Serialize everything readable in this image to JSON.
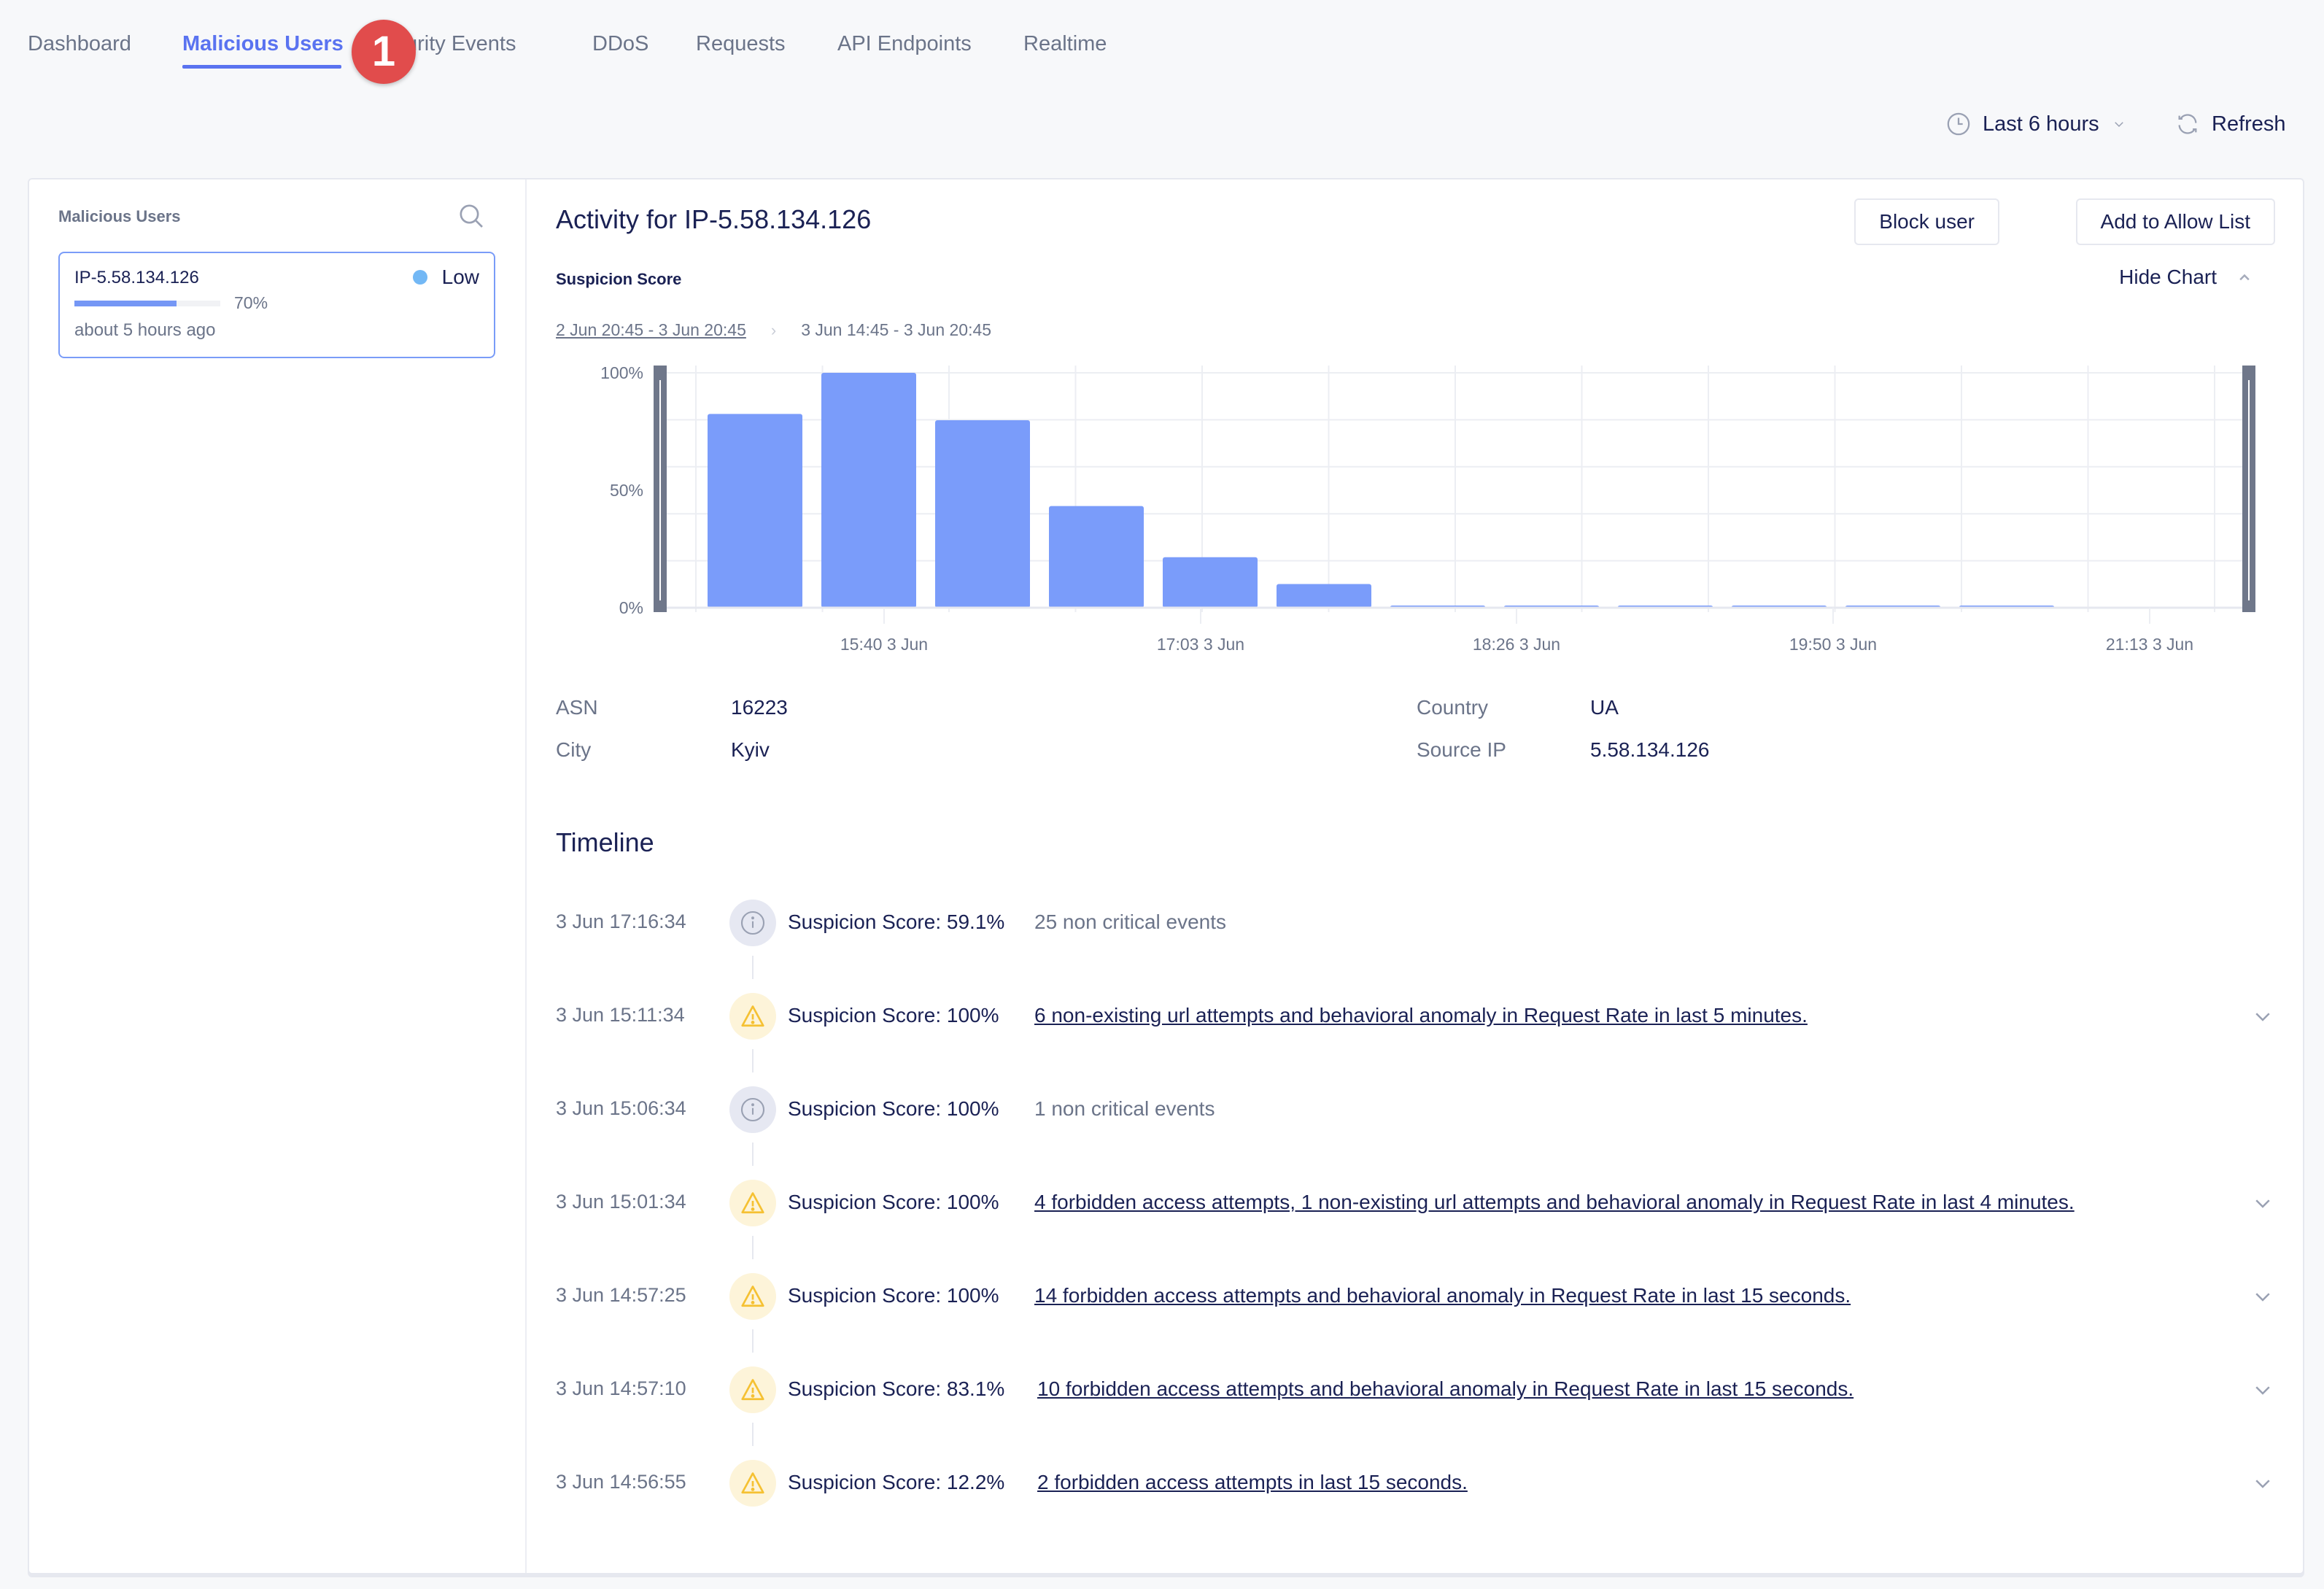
{
  "nav": {
    "tabs": [
      {
        "label": "Dashboard",
        "active": false
      },
      {
        "label": "Malicious Users",
        "active": true
      },
      {
        "label": "Security Events",
        "active": false
      },
      {
        "label": "DDoS",
        "active": false
      },
      {
        "label": "Requests",
        "active": false
      },
      {
        "label": "API Endpoints",
        "active": false
      },
      {
        "label": "Realtime",
        "active": false
      }
    ],
    "badge": "1"
  },
  "toolbar": {
    "time_range": "Last 6 hours",
    "refresh": "Refresh"
  },
  "left_panel": {
    "title": "Malicious Users",
    "users": [
      {
        "ip": "IP-5.58.134.126",
        "level": "Low",
        "level_color": "#73b8f5",
        "score_percent": 70,
        "score_label": "70%",
        "last_seen": "about 5 hours ago"
      }
    ]
  },
  "detail": {
    "title": "Activity for IP-5.58.134.126",
    "block_button": "Block user",
    "allow_button": "Add to Allow List",
    "score_title": "Suspicion Score",
    "hide_chart": "Hide Chart",
    "range_outer": "2 Jun 20:45 - 3 Jun 20:45",
    "range_inner": "3 Jun 14:45 - 3 Jun 20:45",
    "info": [
      {
        "label": "ASN",
        "value": "16223"
      },
      {
        "label": "City",
        "value": "Kyiv"
      },
      {
        "label": "Country",
        "value": "UA"
      },
      {
        "label": "Source IP",
        "value": "5.58.134.126"
      }
    ],
    "timeline_title": "Timeline",
    "timeline": [
      {
        "time": "3 Jun 17:16:34",
        "type": "info",
        "score": "Suspicion Score: 59.1%",
        "desc": "25 non critical events",
        "link": false
      },
      {
        "time": "3 Jun 15:11:34",
        "type": "warn",
        "score": "Suspicion Score: 100%",
        "desc": "6 non-existing url attempts and behavioral anomaly in Request Rate in last 5 minutes.",
        "link": true
      },
      {
        "time": "3 Jun 15:06:34",
        "type": "info",
        "score": "Suspicion Score: 100%",
        "desc": "1 non critical events",
        "link": false
      },
      {
        "time": "3 Jun 15:01:34",
        "type": "warn",
        "score": "Suspicion Score: 100%",
        "desc": "4 forbidden access attempts, 1 non-existing url attempts and behavioral anomaly in Request Rate in last 4 minutes.",
        "link": true
      },
      {
        "time": "3 Jun 14:57:25",
        "type": "warn",
        "score": "Suspicion Score: 100%",
        "desc": "14 forbidden access attempts and behavioral anomaly in Request Rate in last 15 seconds.",
        "link": true
      },
      {
        "time": "3 Jun 14:57:10",
        "type": "warn",
        "score": "Suspicion Score: 83.1%",
        "desc": "10 forbidden access attempts and behavioral anomaly in Request Rate in last 15 seconds.",
        "link": true
      },
      {
        "time": "3 Jun 14:56:55",
        "type": "warn",
        "score": "Suspicion Score: 12.2%",
        "desc": "2 forbidden access attempts in last 15 seconds.",
        "link": true
      }
    ]
  },
  "colors": {
    "accent": "#5a73f0",
    "bar": "#7a9cfa",
    "badge": "#e14c4c",
    "warn": "#f5c133"
  },
  "chart_data": {
    "type": "bar",
    "title": "Suspicion Score",
    "xlabel": "",
    "ylabel": "",
    "ylim": [
      0,
      100
    ],
    "yticks": [
      "0%",
      "50%",
      "100%"
    ],
    "xticks": [
      "15:40 3 Jun",
      "17:03 3 Jun",
      "18:26 3 Jun",
      "19:50 3 Jun",
      "21:13 3 Jun"
    ],
    "grid": true,
    "values": [
      82.5,
      100,
      79.8,
      43.3,
      21.5,
      10.1,
      0.5,
      0.5,
      0.5,
      0.5,
      0.5,
      0.5
    ]
  }
}
